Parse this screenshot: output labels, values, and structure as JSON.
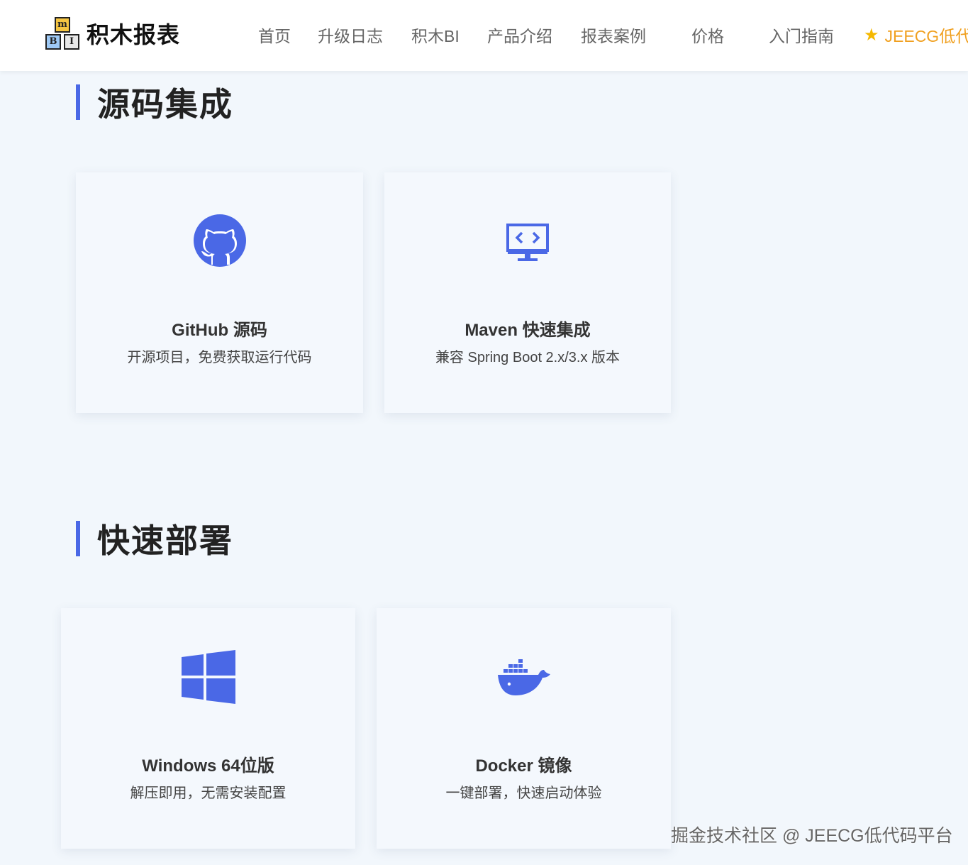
{
  "header": {
    "logo_text": "积木报表",
    "logo_blocks": [
      "m",
      "B",
      "I"
    ],
    "nav": [
      {
        "label": "首页"
      },
      {
        "label": "升级日志"
      },
      {
        "label": "积木BI"
      },
      {
        "label": "产品介绍"
      },
      {
        "label": "报表案例"
      },
      {
        "label": "价格"
      },
      {
        "label": "入门指南"
      }
    ],
    "highlight_link": {
      "label": "JEECG低代",
      "icon": "star-icon"
    }
  },
  "sections": [
    {
      "title": "源码集成",
      "cards": [
        {
          "icon": "github-icon",
          "title": "GitHub 源码",
          "desc": "开源项目，免费获取运行代码"
        },
        {
          "icon": "code-monitor-icon",
          "title": "Maven 快速集成",
          "desc": "兼容 Spring Boot 2.x/3.x 版本"
        }
      ]
    },
    {
      "title": "快速部署",
      "cards": [
        {
          "icon": "windows-icon",
          "title": "Windows 64位版",
          "desc": "解压即用，无需安装配置"
        },
        {
          "icon": "docker-icon",
          "title": "Docker 镜像",
          "desc": "一键部署，快速启动体验"
        }
      ]
    }
  ],
  "watermark": "掘金技术社区 @ JEECG低代码平台",
  "colors": {
    "accent": "#4a68e6",
    "background": "#f2f7fc",
    "highlight": "#f0a020"
  }
}
